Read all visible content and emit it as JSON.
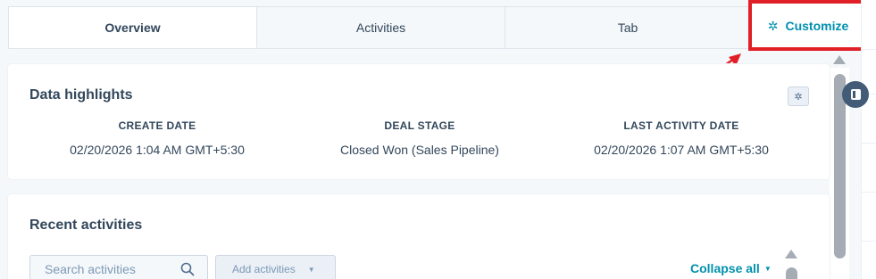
{
  "tabs": [
    {
      "label": "Overview",
      "active": true
    },
    {
      "label": "Activities",
      "active": false
    },
    {
      "label": "Tab",
      "active": false
    }
  ],
  "customize": {
    "label": "Customize",
    "icon": "gear-icon",
    "highlight_color": "#e01f26"
  },
  "data_highlights": {
    "title": "Data highlights",
    "columns": [
      {
        "label": "CREATE DATE",
        "value": "02/20/2026 1:04 AM GMT+5:30"
      },
      {
        "label": "DEAL STAGE",
        "value": "Closed Won (Sales Pipeline)"
      },
      {
        "label": "LAST ACTIVITY DATE",
        "value": "02/20/2026 1:07 AM GMT+5:30"
      }
    ]
  },
  "recent_activities": {
    "title": "Recent activities",
    "search_placeholder": "Search activities",
    "add_label": "Add activities",
    "collapse_label": "Collapse all"
  },
  "colors": {
    "accent": "#0091ae",
    "text": "#33475b",
    "annotation": "#e01f26"
  }
}
